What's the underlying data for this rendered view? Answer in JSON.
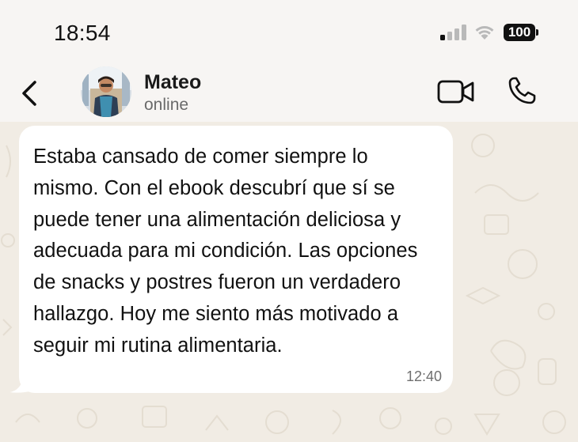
{
  "status_bar": {
    "time": "18:54",
    "battery": "100",
    "icons": [
      "signal-icon",
      "wifi-icon",
      "battery-icon"
    ]
  },
  "header": {
    "contact_name": "Mateo",
    "contact_status": "online",
    "icons": [
      "chevron-left-icon",
      "video-camera-icon",
      "phone-icon"
    ]
  },
  "messages": [
    {
      "text": "Estaba cansado de comer siempre lo mismo. Con el ebook descubrí que sí se puede tener una alimentación deliciosa y adecuada para mi condición. Las opciones de snacks y postres fueron un verdadero hallazgo. Hoy me siento más motivado a seguir mi rutina alimentaria.",
      "time": "12:40"
    }
  ],
  "colors": {
    "background": "#f7f5f3",
    "chat_wallpaper": "#f1ece4",
    "bubble": "#ffffff",
    "text": "#111111",
    "secondary_text": "#6a6a6a"
  }
}
